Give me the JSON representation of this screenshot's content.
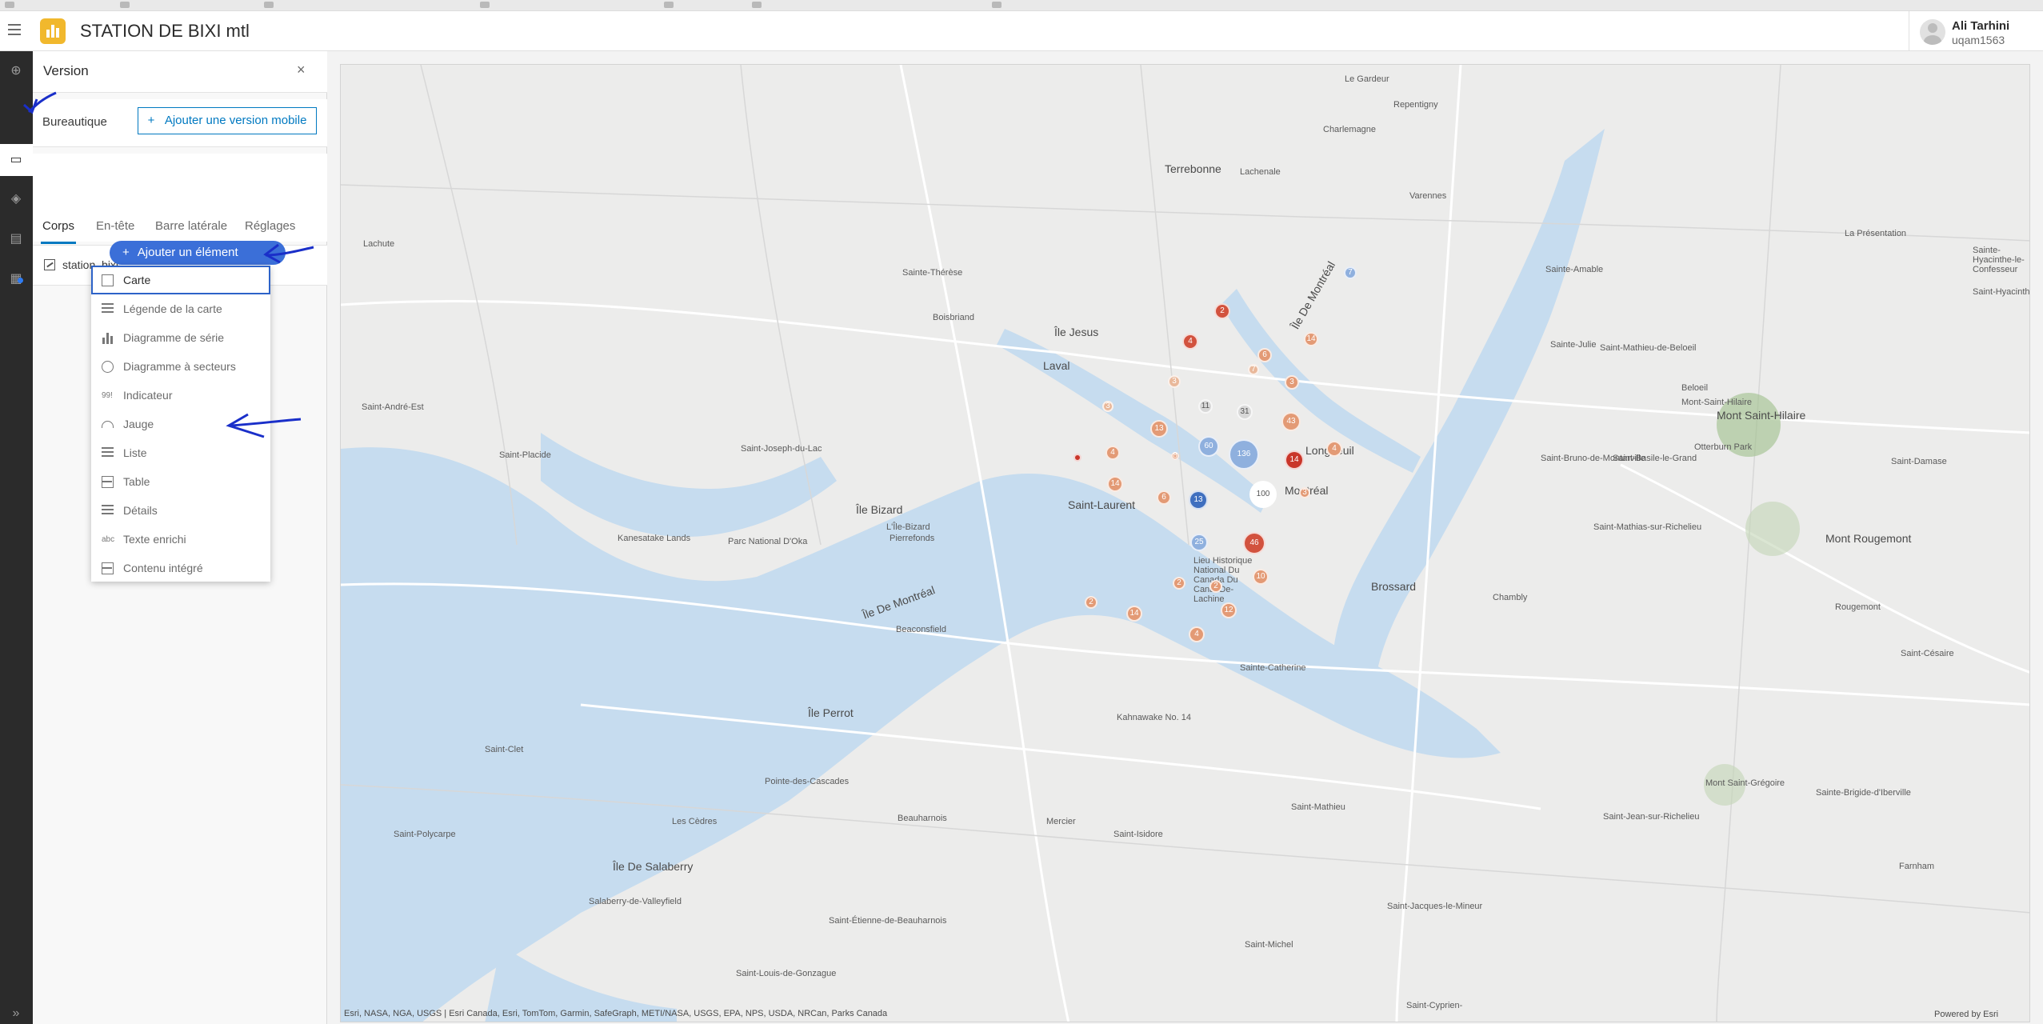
{
  "app": {
    "title": "STATION DE BIXI mtl",
    "user_name": "Ali Tarhini",
    "user_login": "uqam1563"
  },
  "sidebar_icons": [
    "add-icon",
    "desktop-icon",
    "theme-icon",
    "layout-icon",
    "settings-icon",
    "expand-icon"
  ],
  "panel": {
    "title": "Version",
    "close": "×",
    "version_label": "Bureautique",
    "mobile_button": "Ajouter une version mobile",
    "tabs": [
      "Corps",
      "En-tête",
      "Barre latérale",
      "Réglages"
    ],
    "element": "station_bixi_",
    "add_button": "Ajouter un élément"
  },
  "menu": [
    {
      "label": "Carte",
      "icon": "map-icon"
    },
    {
      "label": "Légende de la carte",
      "icon": "legend-icon"
    },
    {
      "label": "Diagramme de série",
      "icon": "bar-chart-icon"
    },
    {
      "label": "Diagramme à secteurs",
      "icon": "pie-chart-icon"
    },
    {
      "label": "Indicateur",
      "icon": "indicator-icon"
    },
    {
      "label": "Jauge",
      "icon": "gauge-icon"
    },
    {
      "label": "Liste",
      "icon": "list-icon"
    },
    {
      "label": "Table",
      "icon": "table-icon"
    },
    {
      "label": "Détails",
      "icon": "details-icon"
    },
    {
      "label": "Texte enrichi",
      "icon": "rich-text-icon"
    },
    {
      "label": "Contenu intégré",
      "icon": "embedded-icon"
    }
  ],
  "map": {
    "places": [
      "Le Gardeur",
      "Repentigny",
      "Charlemagne",
      "Terrebonne",
      "Lachenale",
      "Varennes",
      "Lachute",
      "Sainte-Thérèse",
      "Boisbriand",
      "Île Jesus",
      "Laval",
      "Sainte-Amable",
      "La Présentation",
      "Sainte-Julie",
      "Saint-Mathieu-de-Beloeil",
      "Beloeil",
      "Mont-Saint-Hilaire",
      "Mont Saint-Hilaire",
      "Otterburn Park",
      "Saint-Damase",
      "Saint-Basile-le-Grand",
      "Saint-Bruno-de-Montarville",
      "Longueuil",
      "Montréal",
      "Saint-Laurent",
      "Île Bizard",
      "L'Île-Bizard",
      "Pierrefonds",
      "Saint-Joseph-du-Lac",
      "Saint-Placide",
      "Saint-André-Est",
      "Kanesatake Lands",
      "Parc National D'Oka",
      "Île De Montréal",
      "Beaconsfield",
      "Brossard",
      "Lieu Historique National Du Canada Du Canal-De-Lachine",
      "Chambly",
      "Rougemont",
      "Mont Rougemont",
      "Saint-Mathias-sur-Richelieu",
      "Sainte-Catherine",
      "Kahnawake No. 14",
      "Île Perrot",
      "Saint-Clet",
      "Pointe-des-Cascades",
      "Les Cèdres",
      "Beauharnois",
      "Mercier",
      "Saint-Isidore",
      "Saint-Mathieu",
      "Saint-Polycarpe",
      "Île De Salaberry",
      "Salaberry-de-Valleyfield",
      "Saint-Étienne-de-Beauharnois",
      "Saint-Louis-de-Gonzague",
      "Saint-Jacques-le-Mineur",
      "Saint-Michel",
      "Saint-Jean-sur-Richelieu",
      "Mont Saint-Grégoire",
      "Sainte-Brigide-d'Iberville",
      "Farnham",
      "Saint-Césaire",
      "Saint-Cyprien-",
      "Saint-Hyacinthe",
      "Sainte-Hyacinthe-le-Confesseur",
      "Île De Montréal"
    ],
    "clusters": [
      "2",
      "4",
      "6",
      "7",
      "14",
      "3",
      "3",
      "11",
      "31",
      "13",
      "43",
      "3",
      "4",
      "8",
      "60",
      "136",
      "14",
      "4",
      "14",
      "6",
      "13",
      "100",
      "3",
      "25",
      "46",
      "10",
      "2",
      "2",
      "4",
      "2",
      "14",
      "12",
      "4",
      "7"
    ],
    "attribution": "Esri, NASA, NGA, USGS | Esri Canada, Esri, TomTom, Garmin, SafeGraph, METI/NASA, USGS, EPA, NPS, USDA, NRCan, Parks Canada",
    "powered": "Powered by Esri"
  },
  "colors": {
    "accent": "#0079c1",
    "add_button": "#3b6fd8",
    "water": "#c6dcef",
    "land": "#ececeb",
    "cluster_red": "#d2523e",
    "cluster_orange": "#e39a75",
    "cluster_blue": "#3f6fbf"
  }
}
